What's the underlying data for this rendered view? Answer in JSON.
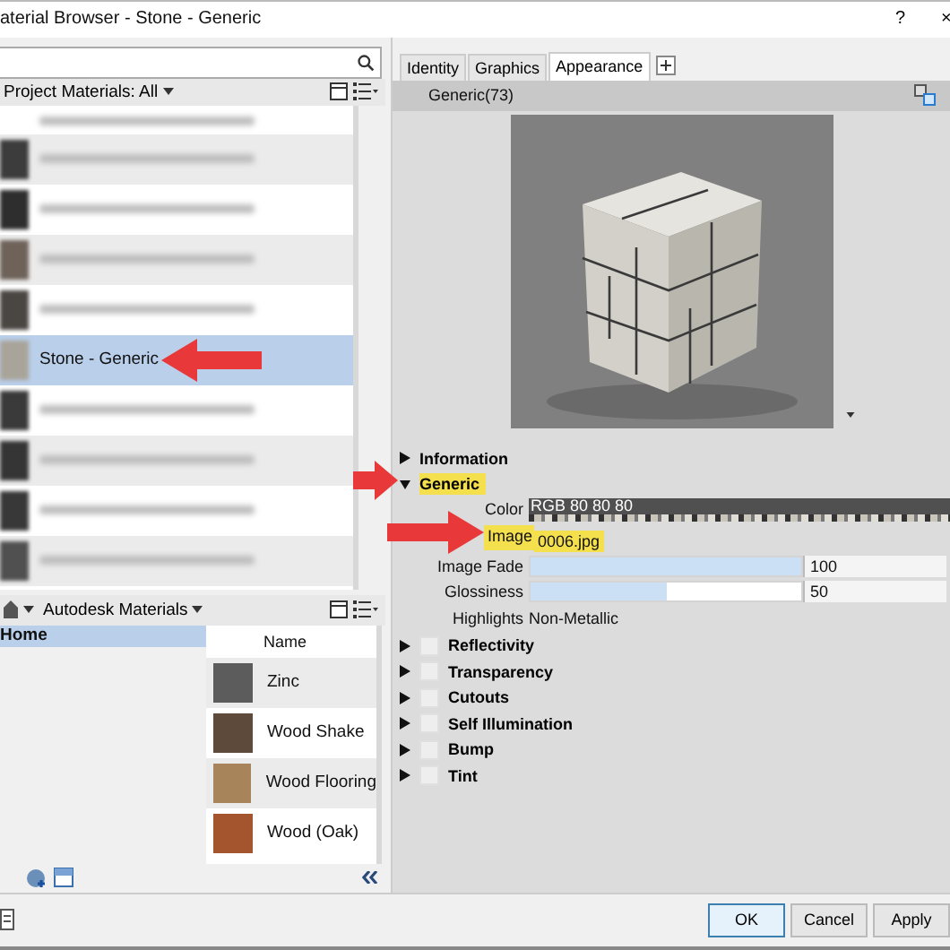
{
  "window": {
    "title": "aterial Browser - Stone - Generic",
    "help": "?",
    "close": "×"
  },
  "project_library": {
    "filter": "Project Materials: All",
    "items": [
      {
        "kind": "blurred",
        "selected": false,
        "arrow": false,
        "color": "#3c3c3c"
      },
      {
        "kind": "blurred",
        "selected": false,
        "arrow": false,
        "color": "#2e2e2e"
      },
      {
        "kind": "blurred",
        "selected": false,
        "arrow": false,
        "color": "#6e6259"
      },
      {
        "kind": "blurred",
        "selected": false,
        "arrow": false,
        "color": "#4a4642"
      },
      {
        "kind": "named",
        "label": "Stone - Generic",
        "selected": true,
        "arrow": true,
        "color": "#a9a49a"
      },
      {
        "kind": "blurred",
        "selected": false,
        "arrow": false,
        "color": "#3a3a3a"
      },
      {
        "kind": "blurred",
        "selected": false,
        "arrow": false,
        "color": "#353535"
      },
      {
        "kind": "blurred",
        "selected": false,
        "arrow": false,
        "color": "#383838"
      },
      {
        "kind": "blurred",
        "selected": false,
        "arrow": false,
        "color": "#505050"
      }
    ]
  },
  "autodesk_library": {
    "title": "Autodesk Materials",
    "tree": [
      {
        "label": "Home",
        "selected": true
      }
    ],
    "column": "Name",
    "items": [
      {
        "label": "Zinc",
        "color": "#5c5c5c"
      },
      {
        "label": "Wood Shake",
        "color": "#5e4a3a"
      },
      {
        "label": "Wood Flooring",
        "color": "#a8845a"
      },
      {
        "label": "Wood (Oak)",
        "color": "#a4552e"
      }
    ]
  },
  "tabs": [
    {
      "label": "Identity",
      "selected": false
    },
    {
      "label": "Graphics",
      "selected": false
    },
    {
      "label": "Appearance",
      "selected": true
    }
  ],
  "asset": {
    "name": "Generic(73)"
  },
  "sections": [
    {
      "kind": "plain",
      "label": "Information",
      "expanded": false,
      "highlighted": false,
      "arrow": false
    },
    {
      "kind": "plain",
      "label": "Generic",
      "expanded": true,
      "highlighted": true,
      "arrow": true,
      "properties": [
        {
          "kind": "color",
          "label": "Color",
          "value": "RGB 80 80 80",
          "highlighted": false,
          "arrow": false
        },
        {
          "kind": "image",
          "label": "Image",
          "value": "0006.jpg",
          "highlighted": true,
          "arrow": true
        },
        {
          "kind": "slider",
          "label": "Image Fade",
          "level": 1,
          "value": "100",
          "highlighted": false,
          "arrow": false
        },
        {
          "kind": "slider",
          "label": "Glossiness",
          "level": 0.5,
          "value": "50",
          "highlighted": false,
          "arrow": false
        },
        {
          "kind": "text",
          "label": "Highlights",
          "value": "Non-Metallic",
          "highlighted": false,
          "arrow": false
        }
      ]
    },
    {
      "kind": "toggle",
      "label": "Reflectivity",
      "expanded": false,
      "checked": false
    },
    {
      "kind": "toggle",
      "label": "Transparency",
      "expanded": false,
      "checked": false
    },
    {
      "kind": "toggle",
      "label": "Cutouts",
      "expanded": false,
      "checked": false
    },
    {
      "kind": "toggle",
      "label": "Self Illumination",
      "expanded": false,
      "checked": false
    },
    {
      "kind": "toggle",
      "label": "Bump",
      "expanded": false,
      "checked": false
    },
    {
      "kind": "toggle",
      "label": "Tint",
      "expanded": false,
      "checked": false
    }
  ],
  "buttons": [
    {
      "label": "OK",
      "default": true
    },
    {
      "label": "Cancel",
      "default": false
    },
    {
      "label": "Apply",
      "default": false
    }
  ]
}
